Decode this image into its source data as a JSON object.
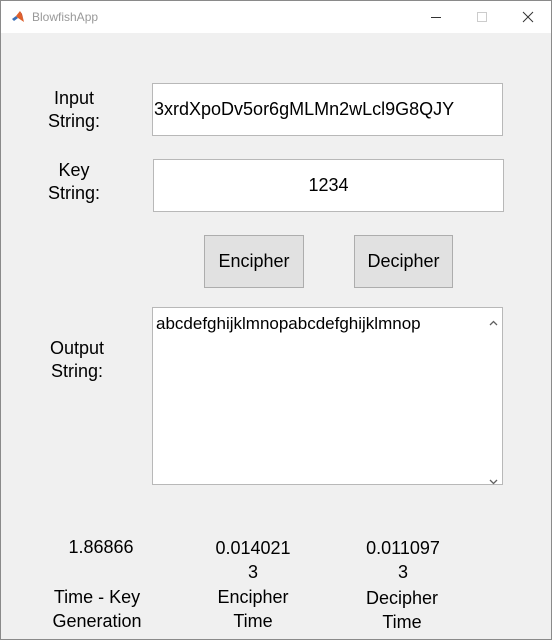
{
  "window": {
    "title": "BlowfishApp"
  },
  "labels": {
    "input_line1": "Input",
    "input_line2": "String:",
    "key_line1": "Key",
    "key_line2": "String:",
    "output_line1": "Output",
    "output_line2": "String:"
  },
  "inputs": {
    "input_string": "3xrdXpoDv5or6gMLMn2wLcl9G8QJY",
    "key_string": "1234"
  },
  "buttons": {
    "encipher": "Encipher",
    "decipher": "Decipher"
  },
  "output": {
    "text": "abcdefghijklmnopabcdefghijklmnop"
  },
  "timings": {
    "key_value": "1.86866",
    "key_label_line1": "Time - Key",
    "key_label_line2": "Generation",
    "encipher_value_line1": "0.014021",
    "encipher_value_line2": "3",
    "encipher_label_line1": "Encipher",
    "encipher_label_line2": "Time",
    "decipher_value_line1": "0.011097",
    "decipher_value_line2": "3",
    "decipher_label_line1": "Decipher",
    "decipher_label_line2": "Time"
  },
  "icons": {
    "app": "matlab-icon",
    "minimize": "minimize-icon",
    "maximize": "maximize-icon",
    "close": "close-icon",
    "scroll_up": "chevron-up-icon",
    "scroll_down": "chevron-down-icon"
  }
}
